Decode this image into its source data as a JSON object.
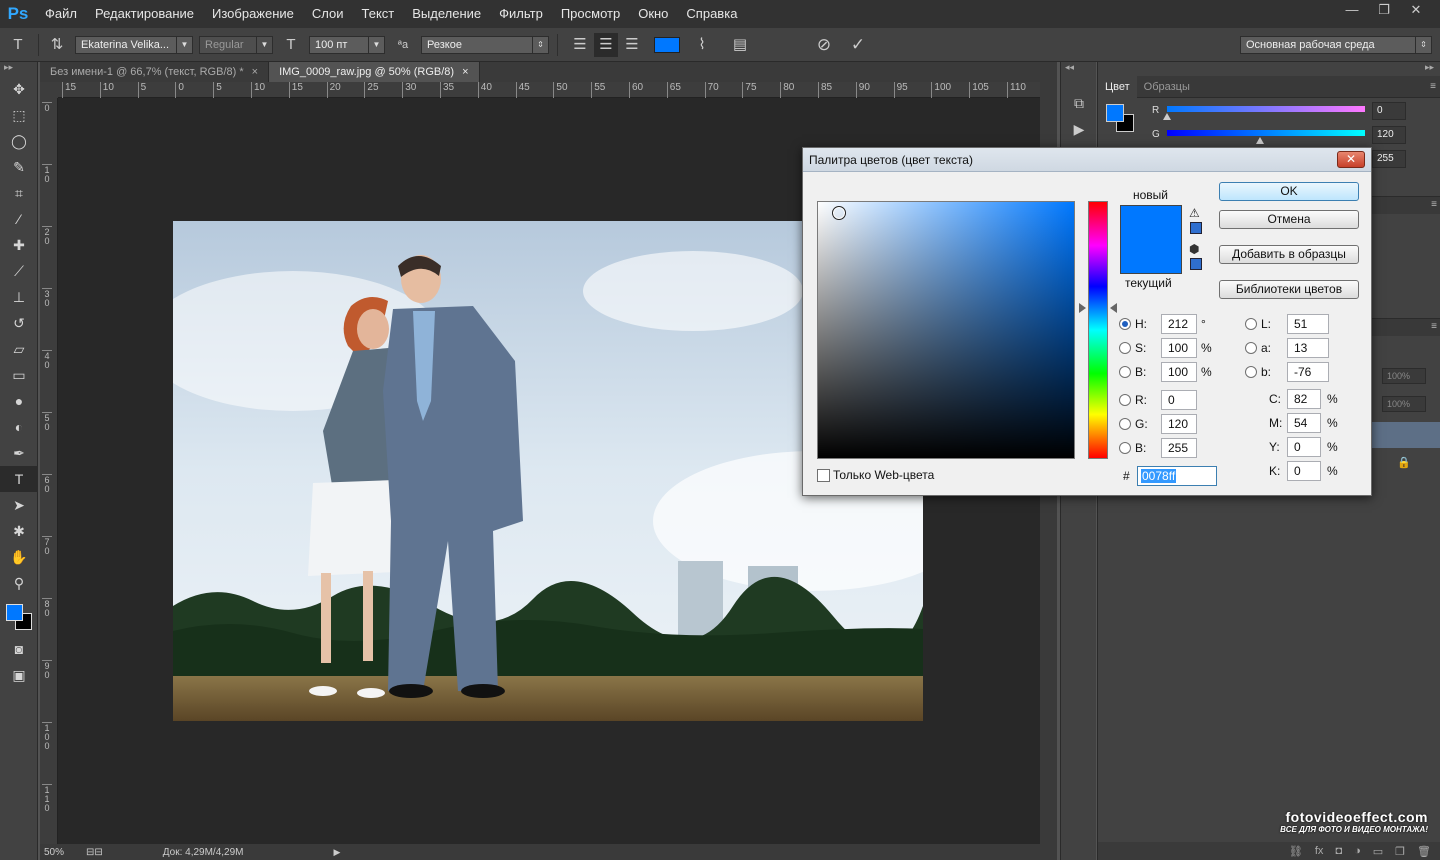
{
  "app": {
    "logo": "Ps"
  },
  "menu": [
    "Файл",
    "Редактирование",
    "Изображение",
    "Слои",
    "Текст",
    "Выделение",
    "Фильтр",
    "Просмотр",
    "Окно",
    "Справка"
  ],
  "window_controls": {
    "minimize": "—",
    "restore": "❐",
    "close": "✕"
  },
  "options": {
    "font_family": "Ekaterina Velika...",
    "font_style": "Regular",
    "font_size": "100 пт",
    "antialias_icon_label": "ªa",
    "antialias": "Резкое",
    "text_color": "#0078ff",
    "workspace": "Основная рабочая среда"
  },
  "tabs": [
    {
      "label": "Без имени-1 @ 66,7% (текст, RGB/8) *",
      "close": "×",
      "active": false
    },
    {
      "label": "IMG_0009_raw.jpg @ 50% (RGB/8)",
      "close": "×",
      "active": true
    }
  ],
  "ruler_top": [
    "15",
    "10",
    "5",
    "0",
    "5",
    "10",
    "15",
    "20",
    "25",
    "30",
    "35",
    "40",
    "45",
    "50",
    "55",
    "60",
    "65",
    "70",
    "75",
    "80",
    "85",
    "90",
    "95",
    "100",
    "105",
    "110"
  ],
  "ruler_left": [
    "0",
    "1 0",
    "2 0",
    "3 0",
    "4 0",
    "5 0",
    "6 0",
    "7 0",
    "8 0",
    "9 0",
    "1 0 0",
    "1 1 0"
  ],
  "status": {
    "zoom": "50%",
    "doc": "Док: 4,29M/4,29M"
  },
  "color_panel": {
    "tabs": [
      "Цвет",
      "Образцы"
    ],
    "fg": "#0078ff",
    "bg": "#000000",
    "channels": [
      {
        "label": "R",
        "value": "0",
        "fraction": 0.0
      },
      {
        "label": "G",
        "value": "120",
        "fraction": 0.47
      },
      {
        "label": "B",
        "value": "255",
        "fraction": 1.0
      }
    ]
  },
  "layers_panel": {
    "opacity": "100%",
    "fill": "100%"
  },
  "watermark": {
    "main": "fotovideoeffect.com",
    "sub": "ВСЕ ДЛЯ ФОТО И ВИДЕО МОНТАЖА!"
  },
  "picker": {
    "title": "Палитра цветов (цвет текста)",
    "close": "✕",
    "label_new": "новый",
    "label_current": "текущий",
    "new_color": "#0078ff",
    "current_color": "#0078ff",
    "buttons": {
      "ok": "OK",
      "cancel": "Отмена",
      "add": "Добавить в образцы",
      "libs": "Библиотеки цветов"
    },
    "hsb": {
      "h_label": "H:",
      "h": "212",
      "h_unit": "°",
      "s_label": "S:",
      "s": "100",
      "s_unit": "%",
      "b_label": "B:",
      "b": "100",
      "b_unit": "%"
    },
    "rgb": {
      "r_label": "R:",
      "r": "0",
      "g_label": "G:",
      "g": "120",
      "b_label": "B:",
      "b": "255"
    },
    "lab": {
      "l_label": "L:",
      "l": "51",
      "a_label": "a:",
      "a": "13",
      "b_label": "b:",
      "b": "-76"
    },
    "cmyk": {
      "c_label": "C:",
      "c": "82",
      "m_label": "M:",
      "m": "54",
      "y_label": "Y:",
      "y": "0",
      "k_label": "K:",
      "k": "0",
      "unit": "%"
    },
    "hex_label": "#",
    "hex": "0078ff",
    "web_only": "Только Web-цвета"
  }
}
